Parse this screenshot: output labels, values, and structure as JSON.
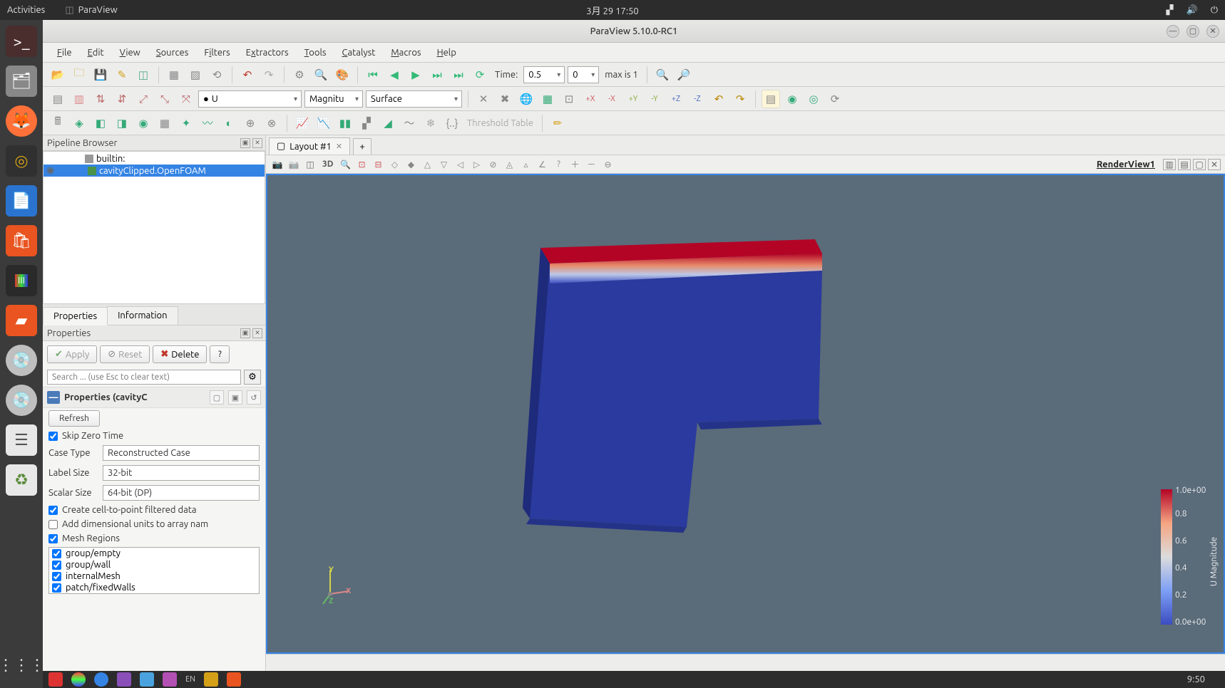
{
  "topbar": {
    "activities": "Activities",
    "app_label": "ParaView",
    "datetime": "3月 29  17:50"
  },
  "window": {
    "title": "ParaView 5.10.0-RC1"
  },
  "menubar": {
    "file": "File",
    "edit": "Edit",
    "view": "View",
    "sources": "Sources",
    "filters": "Filters",
    "extractors": "Extractors",
    "tools": "Tools",
    "catalyst": "Catalyst",
    "macros": "Macros",
    "help": "Help"
  },
  "toolbar1": {
    "time_label": "Time:",
    "time_value": "0.5",
    "frame_value": "0",
    "max_label": "max is 1"
  },
  "toolbar2": {
    "field_combo": "U",
    "component_combo": "Magnitu",
    "representation_combo": "Surface"
  },
  "toolbar3": {
    "threshold_label": "Threshold Table"
  },
  "pipeline": {
    "title": "Pipeline Browser",
    "builtin": "builtin:",
    "source": "cavityClipped.OpenFOAM"
  },
  "tabs": {
    "properties": "Properties",
    "information": "Information"
  },
  "properties_panel": {
    "title": "Properties",
    "apply": "Apply",
    "reset": "Reset",
    "delete": "Delete",
    "help": "?",
    "search_placeholder": "Search ... (use Esc to clear text)",
    "section_title": "Properties (cavityC",
    "refresh": "Refresh",
    "skip_zero": "Skip Zero Time",
    "case_type_label": "Case Type",
    "case_type_value": "Reconstructed Case",
    "label_size_label": "Label Size",
    "label_size_value": "32-bit",
    "scalar_size_label": "Scalar Size",
    "scalar_size_value": "64-bit (DP)",
    "cell_to_point": "Create cell-to-point filtered data",
    "add_units": "Add dimensional units to array nam",
    "mesh_regions": "Mesh Regions",
    "mesh_items": [
      "group/empty",
      "group/wall",
      "internalMesh",
      "patch/fixedWalls"
    ]
  },
  "layout": {
    "tab1": "Layout #1",
    "add": "+",
    "render_view_label": "RenderView1",
    "view_3d": "3D"
  },
  "axes": {
    "x": "X",
    "y": "Y",
    "z": "Z"
  },
  "colorbar": {
    "title": "U Magnitude",
    "t0": "0.0e+00",
    "t1": "0.2",
    "t2": "0.4",
    "t3": "0.6",
    "t4": "0.8",
    "t5": "1.0e+00"
  },
  "bottom_time": "9:50",
  "lang": "EN"
}
